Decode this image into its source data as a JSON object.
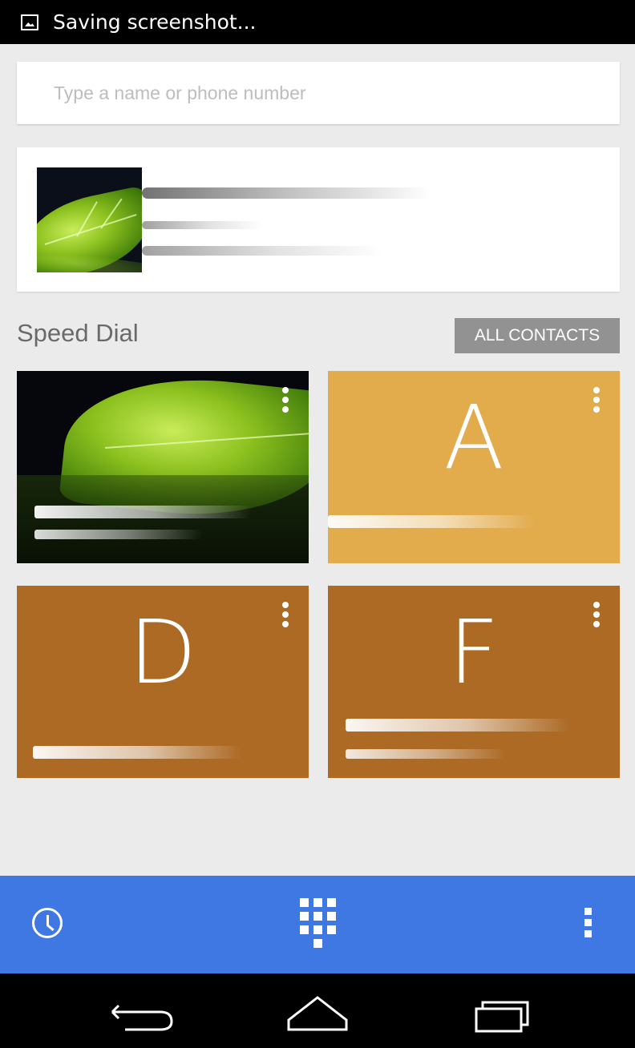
{
  "status_bar": {
    "text": "Saving screenshot..."
  },
  "search": {
    "placeholder": "Type a name or phone number",
    "value": ""
  },
  "speed_dial": {
    "title": "Speed Dial",
    "all_contacts_label": "ALL CONTACTS",
    "tiles": [
      {
        "type": "photo"
      },
      {
        "type": "letter",
        "letter": "A",
        "color": "#e2ab4c"
      },
      {
        "type": "letter",
        "letter": "D",
        "color": "#ac6a25"
      },
      {
        "type": "letter",
        "letter": "F",
        "color": "#ac6a25"
      }
    ]
  },
  "colors": {
    "bottom_bar": "#3f78e3",
    "background": "#ebebeb"
  },
  "icons": {
    "status": "screenshot-icon",
    "recent": "clock-icon",
    "dialpad": "dialpad-icon",
    "overflow": "overflow-menu-icon",
    "back": "back-icon",
    "home": "home-icon",
    "recents": "recent-apps-icon"
  }
}
